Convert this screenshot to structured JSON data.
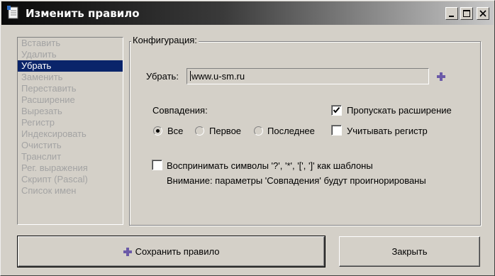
{
  "window": {
    "title": "Изменить правило",
    "controls": [
      "minimize-icon",
      "maximize-icon",
      "close-icon"
    ]
  },
  "sidebar": {
    "items": [
      {
        "label": "Вставить"
      },
      {
        "label": "Удалить"
      },
      {
        "label": "Убрать",
        "selected": true
      },
      {
        "label": "Заменить"
      },
      {
        "label": "Переставить"
      },
      {
        "label": "Расширение"
      },
      {
        "label": "Вырезать"
      },
      {
        "label": "Регистр"
      },
      {
        "label": "Индексировать"
      },
      {
        "label": "Очистить"
      },
      {
        "label": "Транслит"
      },
      {
        "label": "Рег. выражения"
      },
      {
        "label": "Скрипт (Pascal)"
      },
      {
        "label": "Список имен"
      }
    ]
  },
  "config": {
    "legend": "Конфигурация:",
    "remove_label": "Убрать:",
    "remove_value": "www.u-sm.ru",
    "matches_label": "Совпадения:",
    "radios": [
      {
        "label": "Все",
        "checked": true
      },
      {
        "label": "Первое",
        "checked": false
      },
      {
        "label": "Последнее",
        "checked": false
      }
    ],
    "skip_extension": {
      "label": "Пропускать расширение",
      "checked": true
    },
    "case_sensitive": {
      "label": "Учитывать регистр",
      "checked": false
    },
    "wildcards": {
      "label": "Воспринимать символы '?', '*', '[', ']' как шаблоны",
      "checked": false
    },
    "warning": "Внимание: параметры 'Совпадения' будут проигнорированы"
  },
  "footer": {
    "save_label": "Сохранить правило",
    "close_label": "Закрыть"
  },
  "colors": {
    "selection": "#0a246a",
    "disabled_text": "#a3a3a3",
    "plus_icon": "#6b5aa8"
  }
}
